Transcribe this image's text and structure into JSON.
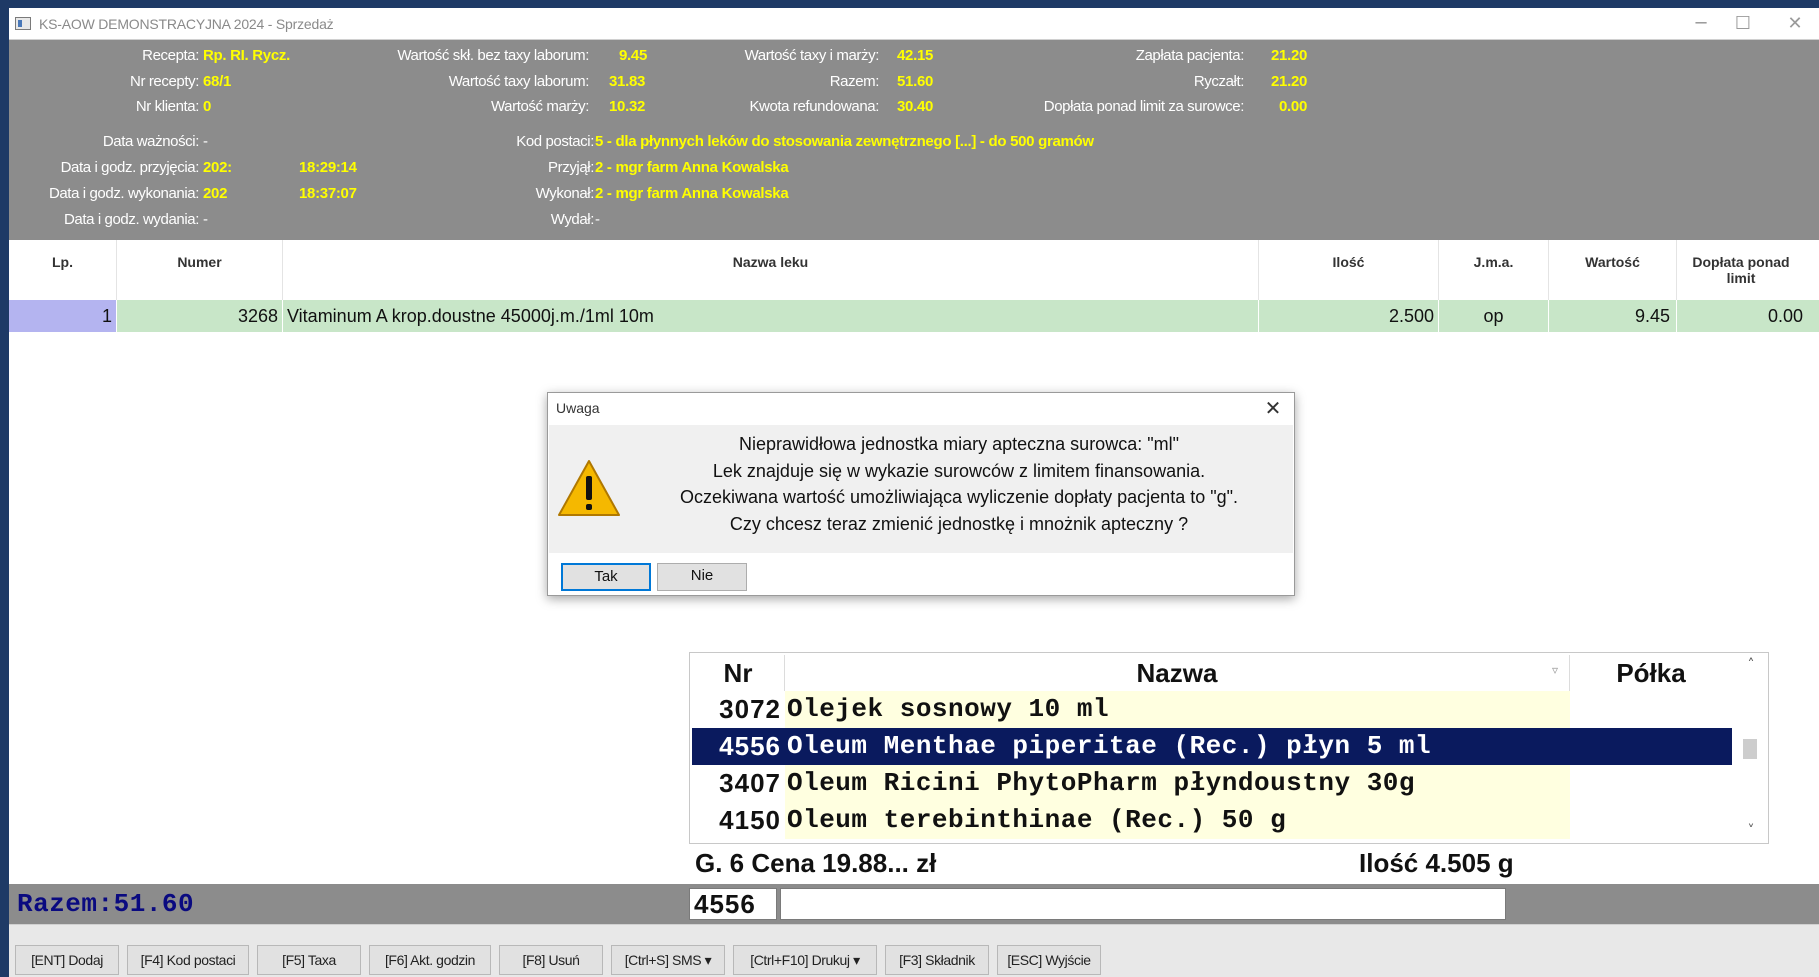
{
  "window": {
    "title": "KS-AOW DEMONSTRACYJNA 2024 - Sprzedaż",
    "minimize_glyph": "─",
    "maximize_glyph": "☐",
    "close_glyph": "✕"
  },
  "info": {
    "recepta_label": "Recepta:",
    "recepta_value": "Rp. RI. Rycz.",
    "nr_recepty_label": "Nr recepty:",
    "nr_recepty_value": "68/1",
    "nr_klienta_label": "Nr klienta:",
    "nr_klienta_value": "0",
    "data_waznosci_label": "Data ważności:",
    "data_waznosci_value": "-",
    "data_przyjecia_label": "Data i godz. przyjęcia:",
    "data_przyjecia_value": "202:",
    "data_przyjecia_time": "18:29:14",
    "data_wykonania_label": "Data i godz. wykonania:",
    "data_wykonania_value": "202",
    "data_wykonania_time": "18:37:07",
    "data_wydania_label": "Data i godz. wydania:",
    "data_wydania_value": "-",
    "wartosc_skl_label": "Wartość skł. bez taxy laborum:",
    "wartosc_skl_value": "9.45",
    "wartosc_taxy_label": "Wartość taxy laborum:",
    "wartosc_taxy_value": "31.83",
    "wartosc_marzy_label": "Wartość marży:",
    "wartosc_marzy_value": "10.32",
    "wartosc_taxy_marzy_label": "Wartość taxy i marży:",
    "wartosc_taxy_marzy_value": "42.15",
    "razem_label": "Razem:",
    "razem_value": "51.60",
    "kwota_ref_label": "Kwota refundowana:",
    "kwota_ref_value": "30.40",
    "zaplata_label": "Zapłata pacjenta:",
    "zaplata_value": "21.20",
    "ryczalt_label": "Ryczałt:",
    "ryczalt_value": "21.20",
    "doplata_label": "Dopłata ponad limit za surowce:",
    "doplata_value": "0.00",
    "kod_postaci_label": "Kod postaci:",
    "kod_postaci_value": "5 - dla płynnych leków do stosowania zewnętrznego [...] - do 500 gramów",
    "przyjal_label": "Przyjął:",
    "przyjal_value": "2 - mgr farm Anna Kowalska",
    "wykonal_label": "Wykonał:",
    "wykonal_value": "2 - mgr farm Anna Kowalska",
    "wydal_label": "Wydał:",
    "wydal_value": "-"
  },
  "table": {
    "headers": [
      "Lp.",
      "Numer",
      "Nazwa leku",
      "Ilość",
      "J.m.a.",
      "Wartość",
      "Dopłata ponad limit"
    ],
    "rows": [
      {
        "lp": "1",
        "numer": "3268",
        "nazwa": "Vitaminum A krop.doustne 45000j.m./1ml 10m",
        "ilosc": "2.500",
        "jma": "op",
        "wartosc": "9.45",
        "doplata": "0.00"
      }
    ]
  },
  "dialog": {
    "title": "Uwaga",
    "close_glyph": "✕",
    "message": [
      "Nieprawidłowa jednostka miary apteczna surowca: \"ml\"",
      "Lek znajduje się w wykazie surowców z limitem finansowania.",
      "Oczekiwana wartość umożliwiająca wyliczenie dopłaty pacjenta to \"g\".",
      "Czy chcesz teraz zmienić jednostkę i mnożnik apteczny ?"
    ],
    "yes_label": "Tak",
    "no_label": "Nie"
  },
  "picker": {
    "headers": {
      "nr": "Nr",
      "nazwa": "Nazwa",
      "polka": "Półka"
    },
    "rows": [
      {
        "nr": "3072",
        "nazwa": "Olejek sosnowy 10 ml",
        "polka": ""
      },
      {
        "nr": "4556",
        "nazwa": "Oleum Menthae piperitae (Rec.) płyn 5 ml",
        "polka": ""
      },
      {
        "nr": "3407",
        "nazwa": "Oleum Ricini PhytoPharm płyndoustny 30g",
        "polka": ""
      },
      {
        "nr": "4150",
        "nazwa": "Oleum terebinthinae (Rec.) 50 g",
        "polka": ""
      }
    ],
    "selected_nr": "4556",
    "summary_left": "G. 6  Cena 19.88... zł",
    "summary_right": "Ilość 4.505 g"
  },
  "status": {
    "razem_text": "Razem:51.60",
    "code_value": "4556",
    "search_value": ""
  },
  "toolbar": {
    "buttons": [
      "[ENT] Dodaj",
      "[F4] Kod postaci",
      "[F5] Taxa",
      "[F6] Akt. godzin",
      "[F8] Usuń",
      "[Ctrl+S] SMS ▾",
      "[Ctrl+F10] Drukuj ▾",
      "[F3] Składnik",
      "[ESC] Wyjście"
    ]
  },
  "colors": {
    "panel_bg": "#8c8c8c",
    "value_yellow": "#ffff00",
    "row_green": "#c8e6c8",
    "selection_navy": "#0a1a5e",
    "razem_blue": "#0a0a80"
  }
}
